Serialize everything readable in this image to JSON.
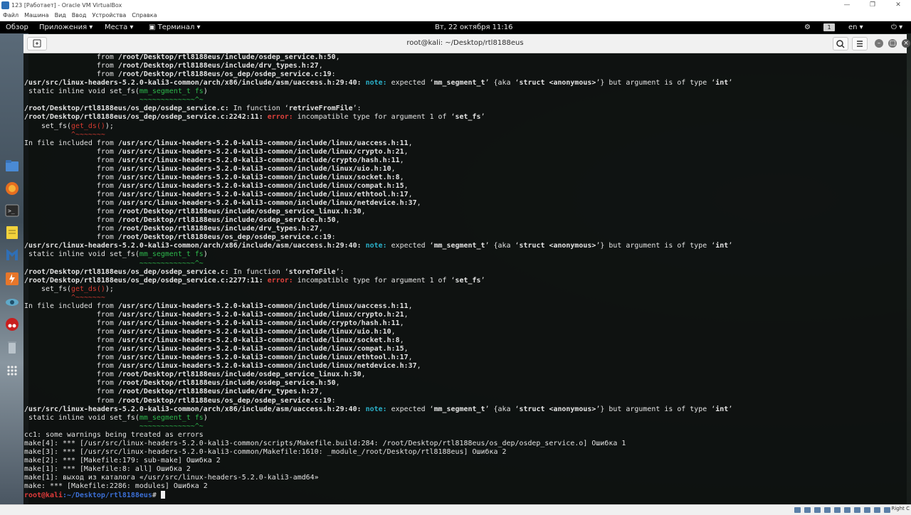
{
  "vbox": {
    "title": "123 [Работает] - Oracle VM VirtualBox",
    "menu": [
      "Файл",
      "Машина",
      "Вид",
      "Ввод",
      "Устройства",
      "Справка"
    ],
    "host_key": "Right C"
  },
  "topbar": {
    "overview": "Обзор",
    "applications": "Приложения ▾",
    "places": "Места ▾",
    "terminal": "Терминал ▾",
    "clock": "Вт, 22 октября  11:16",
    "workspace": "1",
    "lang": "en ▾",
    "power": "⏻ ▾"
  },
  "terminal": {
    "title": "root@kali: ~/Desktop/rtl8188eus",
    "lines": [
      "                 from <b>/root/Desktop/rtl8188eus/include/osdep_service.h:50</b>,",
      "                 from <b>/root/Desktop/rtl8188eus/include/drv_types.h:27</b>,",
      "                 from <b>/root/Desktop/rtl8188eus/os_dep/osdep_service.c:19</b>:",
      "<b>/usr/src/linux-headers-5.2.0-kali3-common/arch/x86/include/asm/uaccess.h:29:40:</b> <note>note:</note> expected ‘<b>mm_segment_t</b>’ {aka ‘<b>struct &lt;anonymous&gt;</b>’} but argument is of type ‘<b>int</b>’",
      " static inline void set_fs(<grn>mm_segment_t fs</grn>)",
      "                           <grn>~~~~~~~~~~~~~^~</grn>",
      "<b>/root/Desktop/rtl8188eus/os_dep/osdep_service.c:</b> In function ‘<b>retriveFromFile</b>’:",
      "<b>/root/Desktop/rtl8188eus/os_dep/osdep_service.c:2242:11:</b> <err>error:</err> incompatible type for argument 1 of ‘<b>set_fs</b>’",
      "    set_fs(<red>get_ds()</red>);",
      "           <red>^~~~~~~~</red>",
      "In file included from <b>/usr/src/linux-headers-5.2.0-kali3-common/include/linux/uaccess.h:11</b>,",
      "                 from <b>/usr/src/linux-headers-5.2.0-kali3-common/include/linux/crypto.h:21</b>,",
      "                 from <b>/usr/src/linux-headers-5.2.0-kali3-common/include/crypto/hash.h:11</b>,",
      "                 from <b>/usr/src/linux-headers-5.2.0-kali3-common/include/linux/uio.h:10</b>,",
      "                 from <b>/usr/src/linux-headers-5.2.0-kali3-common/include/linux/socket.h:8</b>,",
      "                 from <b>/usr/src/linux-headers-5.2.0-kali3-common/include/linux/compat.h:15</b>,",
      "                 from <b>/usr/src/linux-headers-5.2.0-kali3-common/include/linux/ethtool.h:17</b>,",
      "                 from <b>/usr/src/linux-headers-5.2.0-kali3-common/include/linux/netdevice.h:37</b>,",
      "                 from <b>/root/Desktop/rtl8188eus/include/osdep_service_linux.h:30</b>,",
      "                 from <b>/root/Desktop/rtl8188eus/include/osdep_service.h:50</b>,",
      "                 from <b>/root/Desktop/rtl8188eus/include/drv_types.h:27</b>,",
      "                 from <b>/root/Desktop/rtl8188eus/os_dep/osdep_service.c:19</b>:",
      "<b>/usr/src/linux-headers-5.2.0-kali3-common/arch/x86/include/asm/uaccess.h:29:40:</b> <note>note:</note> expected ‘<b>mm_segment_t</b>’ {aka ‘<b>struct &lt;anonymous&gt;</b>’} but argument is of type ‘<b>int</b>’",
      " static inline void set_fs(<grn>mm_segment_t fs</grn>)",
      "                           <grn>~~~~~~~~~~~~~^~</grn>",
      "<b>/root/Desktop/rtl8188eus/os_dep/osdep_service.c:</b> In function ‘<b>storeToFile</b>’:",
      "<b>/root/Desktop/rtl8188eus/os_dep/osdep_service.c:2277:11:</b> <err>error:</err> incompatible type for argument 1 of ‘<b>set_fs</b>’",
      "    set_fs(<red>get_ds()</red>);",
      "           <red>^~~~~~~~</red>",
      "In file included from <b>/usr/src/linux-headers-5.2.0-kali3-common/include/linux/uaccess.h:11</b>,",
      "                 from <b>/usr/src/linux-headers-5.2.0-kali3-common/include/linux/crypto.h:21</b>,",
      "                 from <b>/usr/src/linux-headers-5.2.0-kali3-common/include/crypto/hash.h:11</b>,",
      "                 from <b>/usr/src/linux-headers-5.2.0-kali3-common/include/linux/uio.h:10</b>,",
      "                 from <b>/usr/src/linux-headers-5.2.0-kali3-common/include/linux/socket.h:8</b>,",
      "                 from <b>/usr/src/linux-headers-5.2.0-kali3-common/include/linux/compat.h:15</b>,",
      "                 from <b>/usr/src/linux-headers-5.2.0-kali3-common/include/linux/ethtool.h:17</b>,",
      "                 from <b>/usr/src/linux-headers-5.2.0-kali3-common/include/linux/netdevice.h:37</b>,",
      "                 from <b>/root/Desktop/rtl8188eus/include/osdep_service_linux.h:30</b>,",
      "                 from <b>/root/Desktop/rtl8188eus/include/osdep_service.h:50</b>,",
      "                 from <b>/root/Desktop/rtl8188eus/include/drv_types.h:27</b>,",
      "                 from <b>/root/Desktop/rtl8188eus/os_dep/osdep_service.c:19</b>:",
      "<b>/usr/src/linux-headers-5.2.0-kali3-common/arch/x86/include/asm/uaccess.h:29:40:</b> <note>note:</note> expected ‘<b>mm_segment_t</b>’ {aka ‘<b>struct &lt;anonymous&gt;</b>’} but argument is of type ‘<b>int</b>’",
      " static inline void set_fs(<grn>mm_segment_t fs</grn>)",
      "                           <grn>~~~~~~~~~~~~~^~</grn>",
      "cc1: some warnings being treated as errors",
      "make[4]: *** [/usr/src/linux-headers-5.2.0-kali3-common/scripts/Makefile.build:284: /root/Desktop/rtl8188eus/os_dep/osdep_service.o] Ошибка 1",
      "make[3]: *** [/usr/src/linux-headers-5.2.0-kali3-common/Makefile:1610: _module_/root/Desktop/rtl8188eus] Ошибка 2",
      "make[2]: *** [Makefile:179: sub-make] Ошибка 2",
      "make[1]: *** [Makefile:8: all] Ошибка 2",
      "make[1]: выход из каталога «/usr/src/linux-headers-5.2.0-kali3-amd64»",
      "make: *** [Makefile:2286: modules] Ошибка 2"
    ],
    "prompt_user": "root@kali",
    "prompt_path": ":~/Desktop/rtl8188eus",
    "prompt_symbol": "# "
  },
  "colors": {
    "error": "#e0413c",
    "note": "#2ab0c9",
    "underline_green": "#2db84c",
    "prompt_red": "#e03a3a",
    "prompt_blue": "#3b6fd6"
  },
  "dock_icons": [
    "files-icon",
    "firefox-icon",
    "terminal-icon",
    "notes-icon",
    "metasploit-icon",
    "burpsuite-icon",
    "zenmap-icon",
    "cherrytree-icon",
    "trash-icon",
    "app-grid-icon"
  ]
}
